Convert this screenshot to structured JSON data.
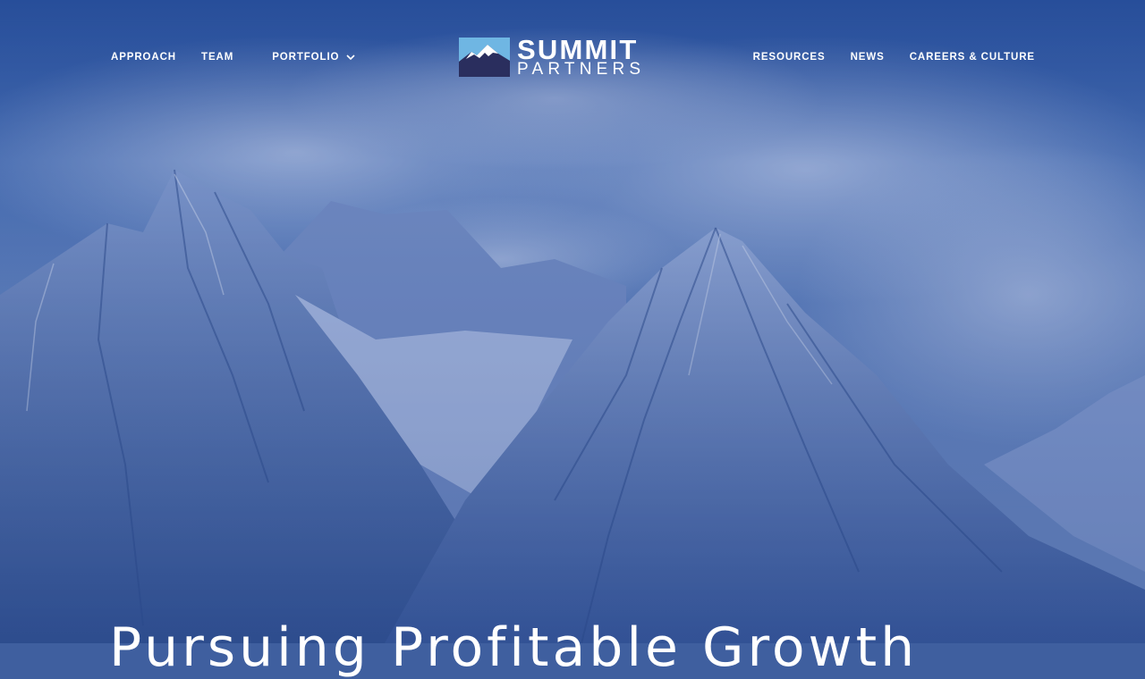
{
  "nav": {
    "left_items": [
      {
        "label": "APPROACH"
      },
      {
        "label": "TEAM"
      },
      {
        "label": "PORTFOLIO"
      }
    ],
    "right_items": [
      {
        "label": "RESOURCES"
      },
      {
        "label": "NEWS"
      },
      {
        "label": "CAREERS & CULTURE"
      }
    ],
    "portfolio_dropdown_icon": "chevron-down-icon"
  },
  "logo": {
    "line1": "SUMMIT",
    "line2": "PARTNERS",
    "icon": "mountain-logo-icon",
    "colors": {
      "sky": "#6fb6e3",
      "mountain": "#2a2e5e",
      "snow": "#ffffff"
    }
  },
  "hero": {
    "headline": "Pursuing Profitable Growth",
    "overlay_color": "#2c4f9c",
    "background_image": "snowy-mountains-image"
  }
}
